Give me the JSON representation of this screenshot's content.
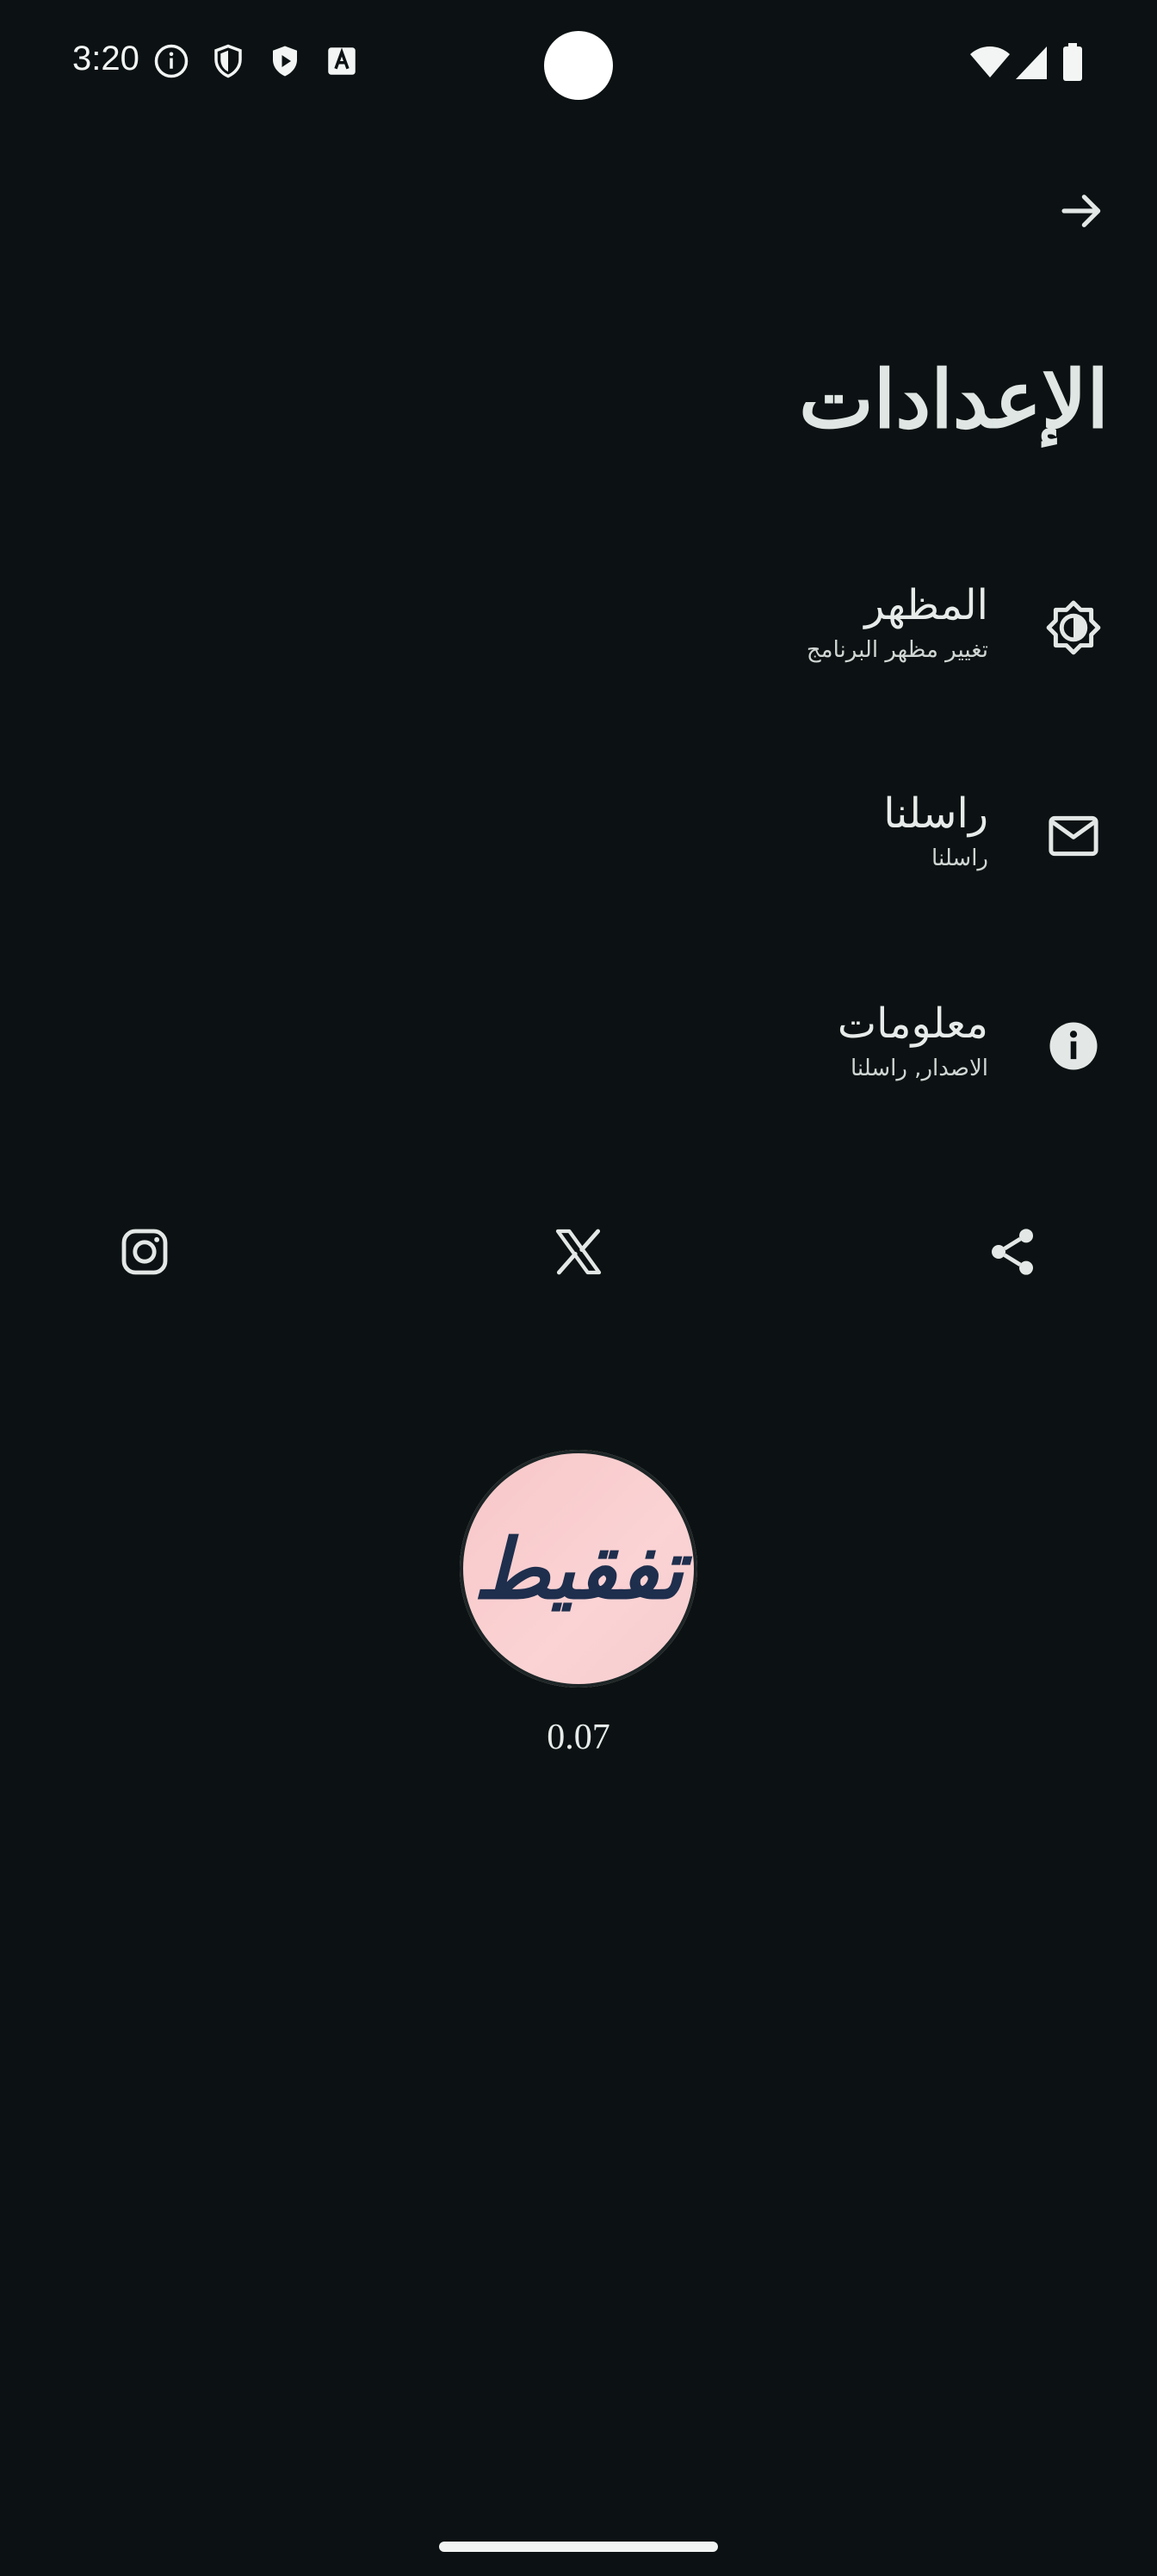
{
  "status_bar": {
    "time": "3:20",
    "left_icons": [
      "info-icon",
      "shield-icon",
      "shield-play-icon",
      "text-a-icon"
    ],
    "right_icons": [
      "wifi-icon",
      "signal-icon",
      "battery-icon"
    ]
  },
  "header": {
    "back_icon": "arrow-right-icon",
    "title": "الإعدادات"
  },
  "settings": {
    "items": [
      {
        "label": "المظهر",
        "subtitle": "تغيير مظهر البرنامج",
        "icon": "brightness-icon"
      },
      {
        "label": "راسلنا",
        "subtitle": "راسلنا",
        "icon": "mail-icon"
      },
      {
        "label": "معلومات",
        "subtitle": "الاصدار, راسلنا",
        "icon": "info-icon"
      }
    ]
  },
  "social": {
    "icons": [
      "instagram-icon",
      "x-twitter-icon",
      "share-icon"
    ]
  },
  "about": {
    "logo_text": "تفقيط",
    "version": "0.07"
  },
  "colors": {
    "background": "#0c1213",
    "text": "#e3e8e6",
    "logo_bg": "#f9cfd1",
    "logo_text": "#1e2e4d"
  }
}
